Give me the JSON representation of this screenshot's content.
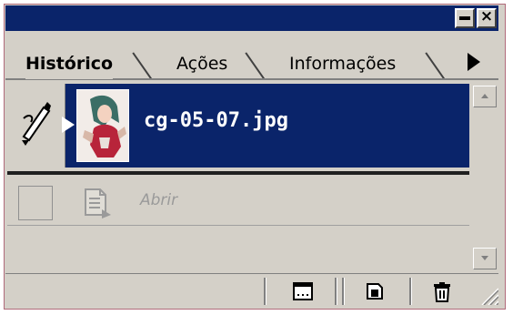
{
  "window": {
    "title_buttons": {
      "minimize_icon": "minimize-icon",
      "close_icon": "close-icon",
      "close_glyph": "×"
    }
  },
  "tabs": [
    {
      "label": "Histórico",
      "active": true
    },
    {
      "label": "Ações",
      "active": false
    },
    {
      "label": "Informações",
      "active": false
    }
  ],
  "palette_menu_icon": "flyout-menu-arrow-icon",
  "history": {
    "snapshot": {
      "name": "cg-05-07.jpg",
      "selected": true,
      "source_icon": "history-brush-icon"
    },
    "steps": [
      {
        "label": "Abrir",
        "icon": "open-document-icon",
        "dimmed": true
      }
    ]
  },
  "footer_buttons": [
    {
      "name": "new-document-from-state-button",
      "icon": "new-document-icon"
    },
    {
      "name": "new-snapshot-button",
      "icon": "snapshot-icon"
    },
    {
      "name": "delete-state-button",
      "icon": "trash-icon"
    }
  ],
  "colors": {
    "title_bar": "#0a246a",
    "selection": "#0a246a",
    "panel": "#d4d0c8",
    "border": "#b06a7a"
  }
}
